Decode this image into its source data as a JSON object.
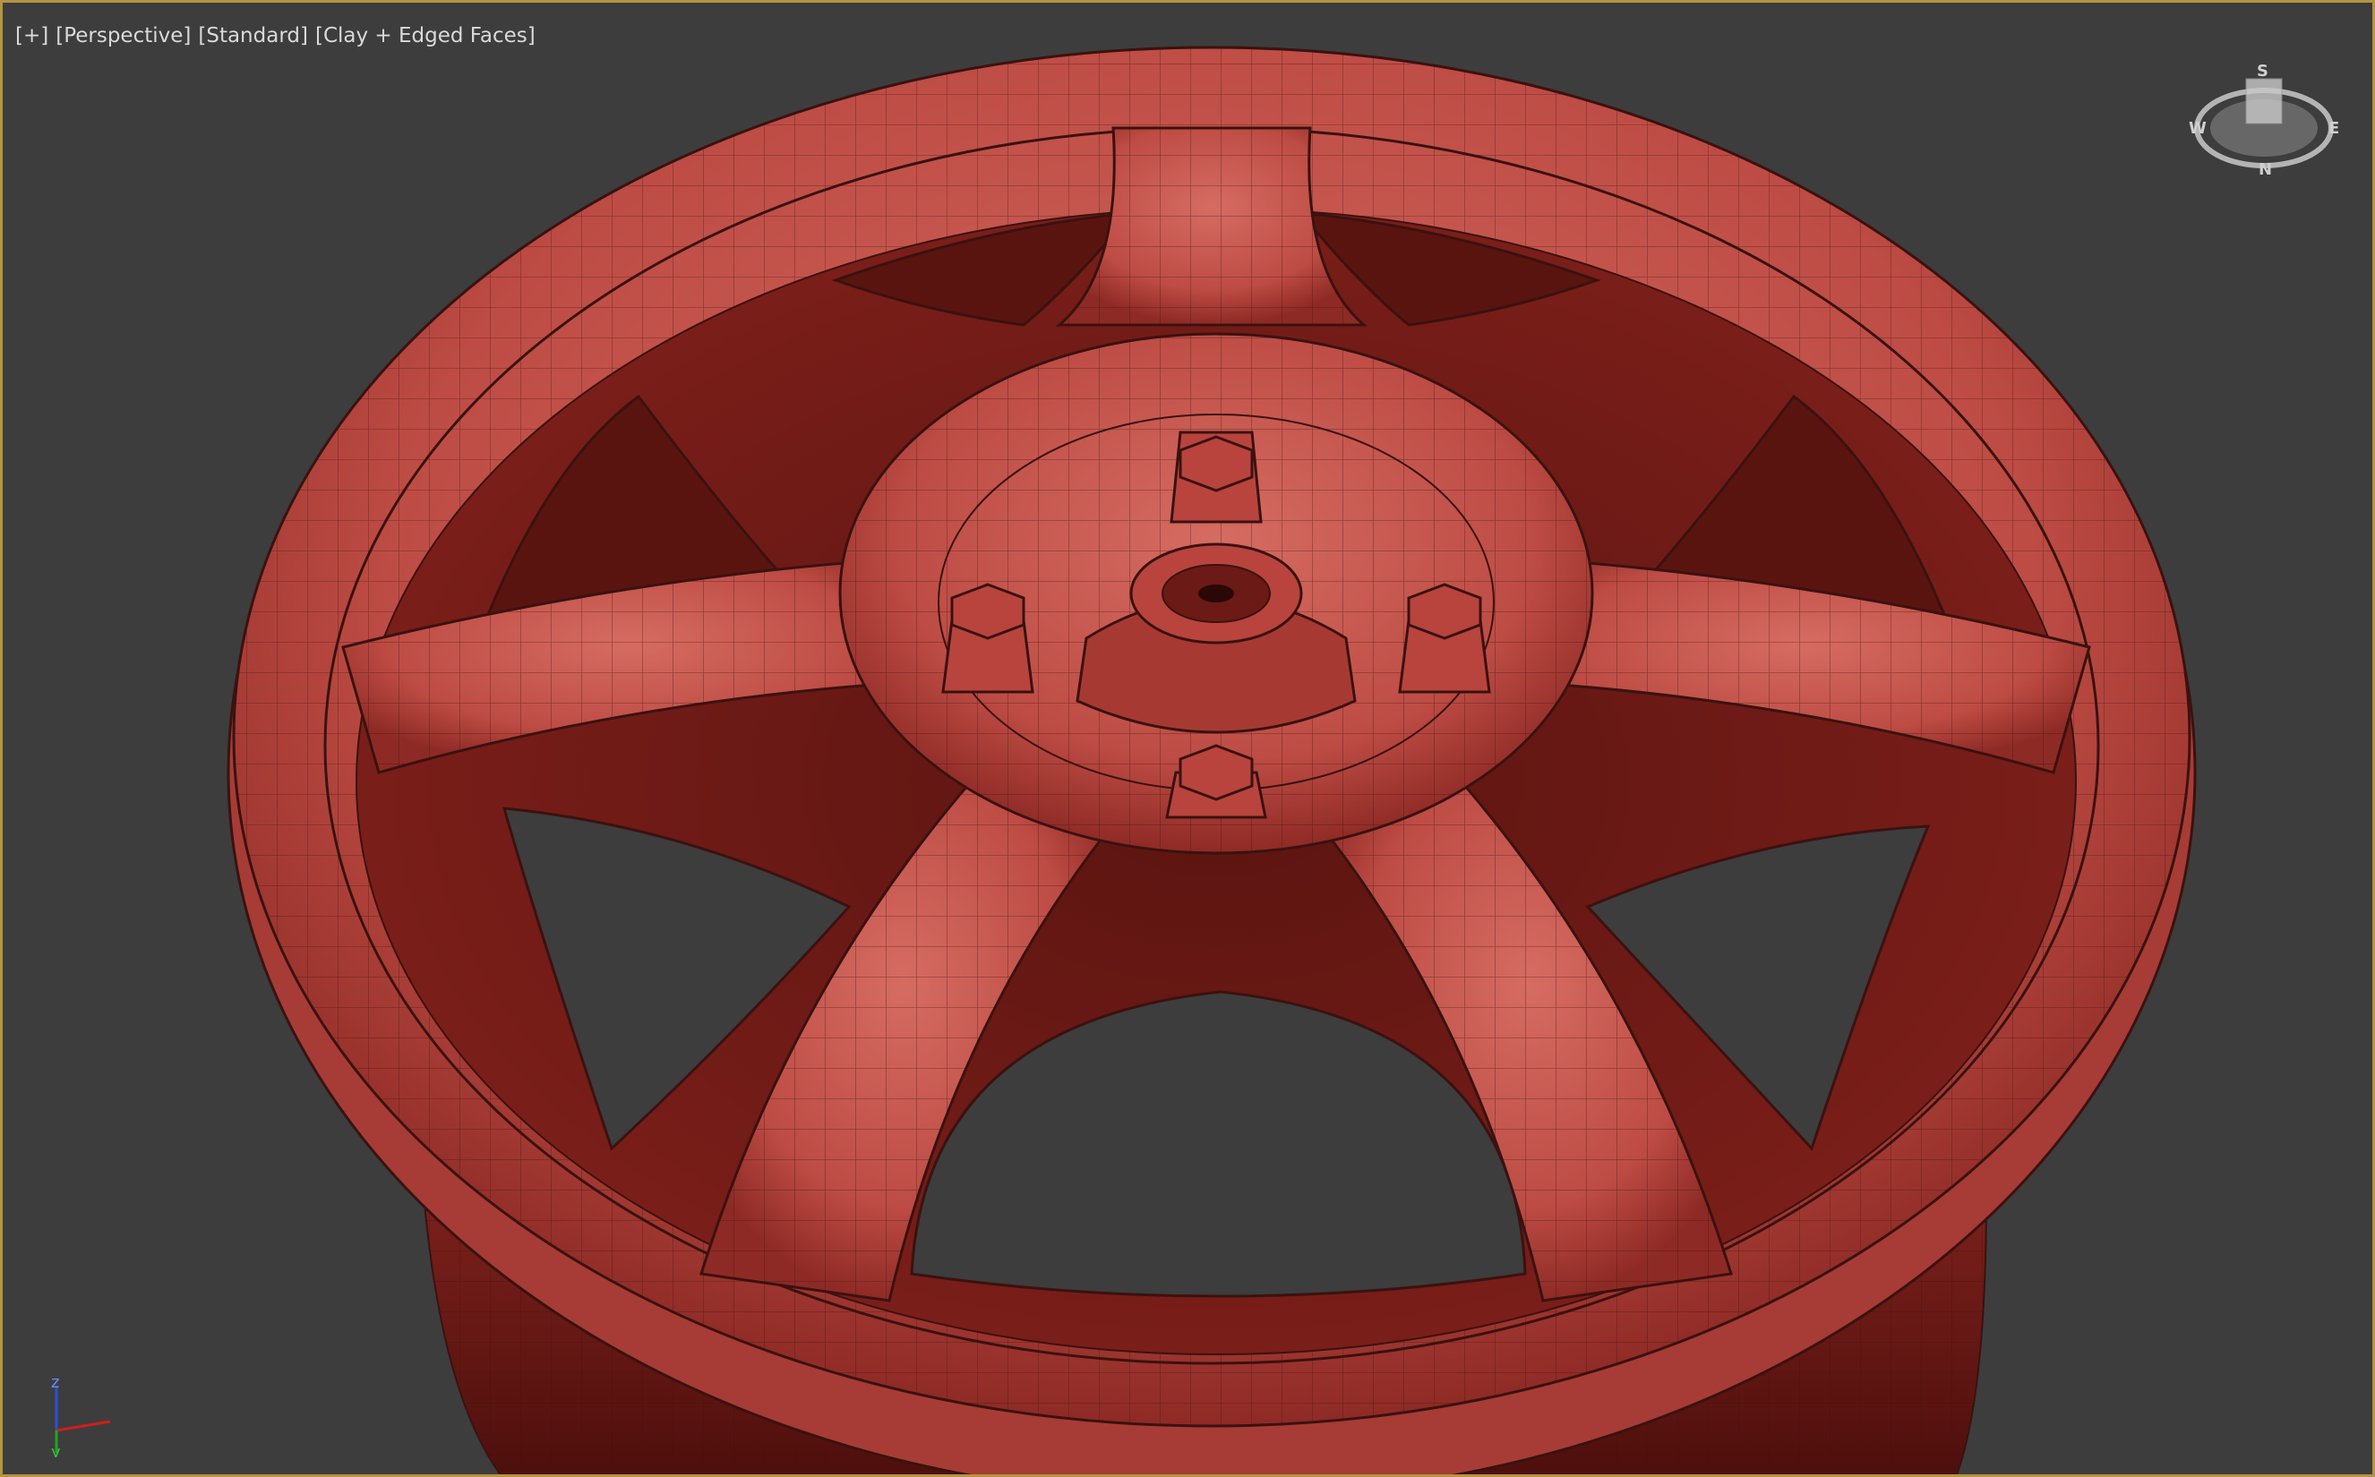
{
  "viewport": {
    "labels": [
      {
        "id": "plus",
        "text": "[+]"
      },
      {
        "id": "perspective",
        "text": "[Perspective]"
      },
      {
        "id": "standard",
        "text": "[Standard]"
      },
      {
        "id": "shading",
        "text": "[Clay + Edged Faces]"
      }
    ],
    "viewcube": {
      "icon": "viewcube-icon",
      "compass": {
        "s": "S",
        "w": "W",
        "e": "E",
        "n": "N"
      }
    },
    "axis_tripod": {
      "icon": "axis-tripod-icon",
      "z_label": "z",
      "y_label": "y",
      "colors": {
        "z": "#2a50d8",
        "y": "#1fa51f",
        "x": "#d21d1d"
      }
    },
    "model": {
      "icon": "wheel-rim-mesh",
      "material_color": "#b84a42",
      "edge_color": "#3a1210",
      "shadow_color": "#6e1c18"
    },
    "border_color": "#b59441",
    "background_color": "#3d3d3d"
  }
}
